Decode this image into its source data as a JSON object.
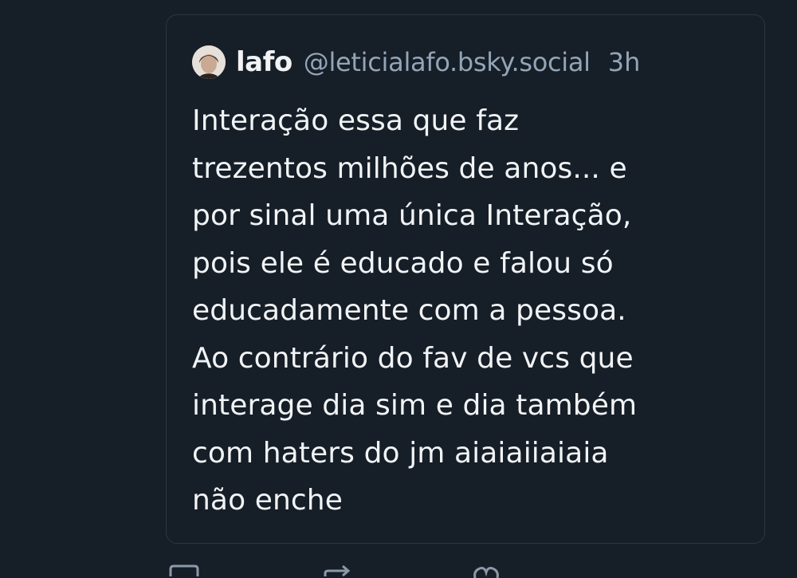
{
  "post": {
    "author": {
      "display_name": "lafo",
      "handle": "@leticialafo.bsky.social",
      "avatar_icon": "avatar-photo"
    },
    "timestamp": "3h",
    "text_lines": [
      "Interação essa que faz",
      "trezentos milhões de anos... e",
      "por sinal uma única Interação,",
      "pois ele é educado e falou só",
      "educadamente com a pessoa.",
      "Ao contrário do fav de vcs que",
      "interage dia sim e dia também",
      "com haters do jm aiaiaiiaiaia",
      "não enche"
    ]
  },
  "actions": {
    "icons": [
      "reply-icon",
      "repost-icon",
      "like-icon"
    ]
  },
  "colors": {
    "background": "#161e27",
    "card_border": "#2b3744",
    "primary_text": "#f1f3f5",
    "secondary_text": "#93a5b7"
  }
}
